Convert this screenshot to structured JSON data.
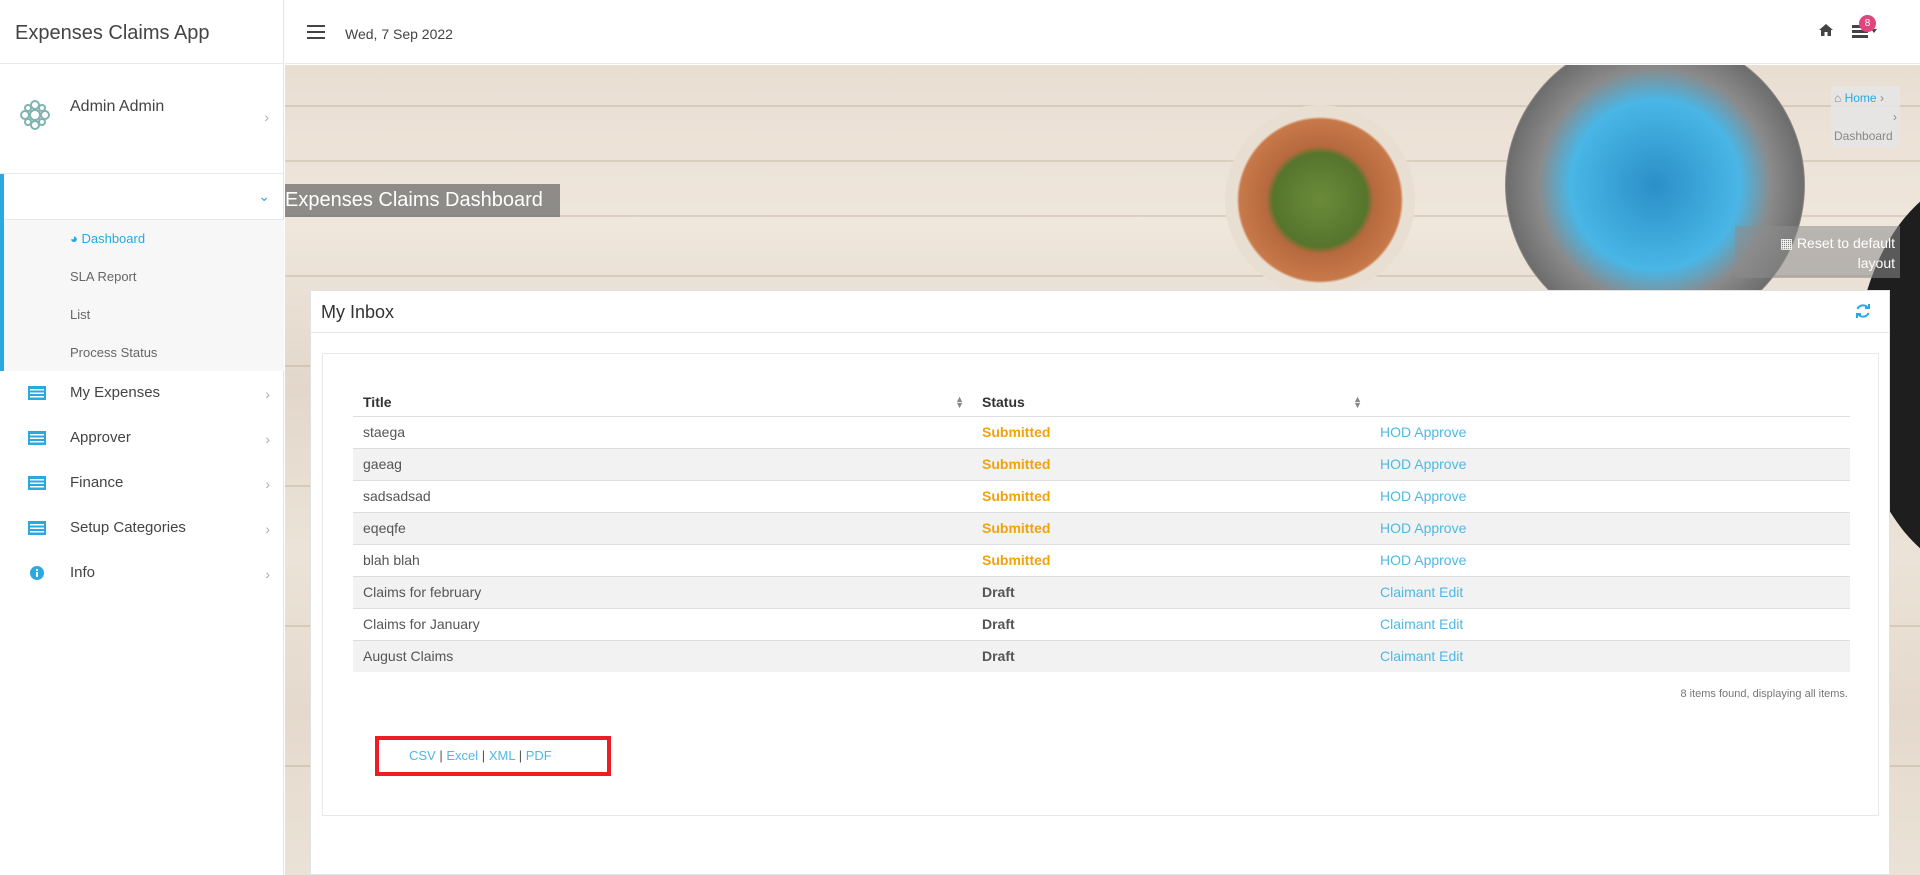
{
  "app": {
    "title": "Expenses Claims App"
  },
  "user": {
    "name": "Admin Admin"
  },
  "topbar": {
    "date": "Wed, 7 Sep 2022",
    "notification_count": "8"
  },
  "sidebar": {
    "submenu": [
      {
        "label": "Dashboard",
        "icon": "dashboard-icon",
        "active": true
      },
      {
        "label": "SLA Report"
      },
      {
        "label": "List"
      },
      {
        "label": "Process Status"
      }
    ],
    "items": [
      {
        "label": "My Expenses",
        "icon": "list-icon"
      },
      {
        "label": "Approver",
        "icon": "list-icon"
      },
      {
        "label": "Finance",
        "icon": "list-icon"
      },
      {
        "label": "Setup Categories",
        "icon": "list-icon"
      },
      {
        "label": "Info",
        "icon": "info-icon"
      }
    ]
  },
  "banner": {
    "title": "Expenses Claims Dashboard",
    "breadcrumb": {
      "home": "Home",
      "current": "Dashboard"
    },
    "reset_label": "Reset to default layout"
  },
  "inbox": {
    "title": "My Inbox",
    "columns": [
      "Title",
      "Status",
      ""
    ],
    "rows": [
      {
        "title": "staega",
        "status": "Submitted",
        "action": "HOD Approve"
      },
      {
        "title": "gaeag",
        "status": "Submitted",
        "action": "HOD Approve"
      },
      {
        "title": "sadsadsad",
        "status": "Submitted",
        "action": "HOD Approve"
      },
      {
        "title": "eqeqfe",
        "status": "Submitted",
        "action": "HOD Approve"
      },
      {
        "title": "blah blah",
        "status": "Submitted",
        "action": "HOD Approve"
      },
      {
        "title": "Claims for february",
        "status": "Draft",
        "action": "Claimant Edit"
      },
      {
        "title": "Claims for January",
        "status": "Draft",
        "action": "Claimant Edit"
      },
      {
        "title": "August Claims",
        "status": "Draft",
        "action": "Claimant Edit"
      }
    ],
    "count_text": "8 items found, displaying all items.",
    "export": {
      "csv": "CSV",
      "excel": "Excel",
      "xml": "XML",
      "pdf": "PDF",
      "separator": "|"
    }
  },
  "colors": {
    "accent": "#2aa8e0",
    "submitted": "#f0a30a",
    "highlight": "#ee1c25",
    "badge": "#e0457b"
  }
}
